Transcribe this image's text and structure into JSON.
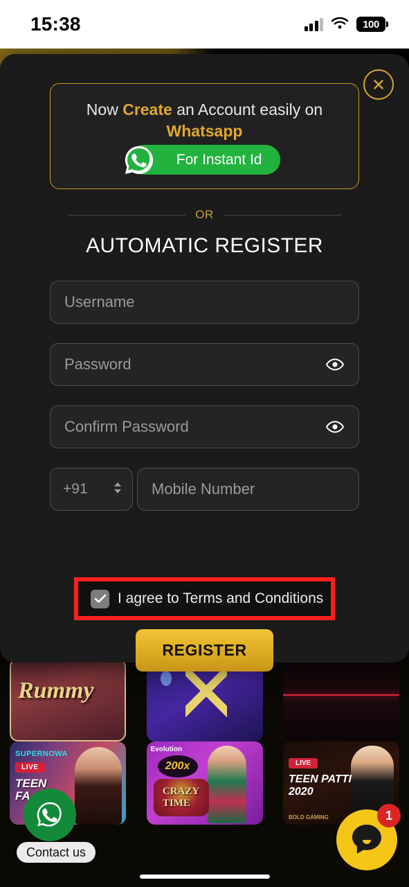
{
  "status_bar": {
    "time": "15:38",
    "battery_level": "100",
    "signal_icon": "cellular-signal-icon",
    "wifi_icon": "wifi-icon",
    "battery_icon": "battery-icon"
  },
  "background": {
    "login_button_label": "",
    "register_button_label": "",
    "cards_row_1": [
      {
        "name": "Rummy",
        "title": "Rummy"
      },
      {
        "name": "blue-game",
        "title": ""
      },
      {
        "name": "dark-game",
        "title": ""
      }
    ],
    "cards_row_2": [
      {
        "name": "teen-patti-fast",
        "provider": "SUPERNOWA",
        "live": "LIVE",
        "title": "TEEN PATTI\nFAST"
      },
      {
        "name": "crazy-time",
        "provider": "Evolution",
        "multiplier": "200x",
        "title": "CRAZY TIME"
      },
      {
        "name": "teen-patti-2020",
        "live": "LIVE",
        "title": "TEEN PATTI 2020",
        "provider": "BOLD GAMING"
      }
    ]
  },
  "modal": {
    "close_icon": "close-circle-icon",
    "promo": {
      "line1_pre": "Now ",
      "line1_accent": "Create",
      "line1_post": " an Account easily on",
      "line2_accent": "Whatsapp",
      "button_label": "For Instant Id",
      "button_icon": "whatsapp-icon"
    },
    "divider_label": "OR",
    "heading": "AUTOMATIC REGISTER",
    "fields": {
      "username": {
        "placeholder": "Username",
        "value": ""
      },
      "password": {
        "placeholder": "Password",
        "value": "",
        "toggle_icon": "eye-icon"
      },
      "confirm_password": {
        "placeholder": "Confirm Password",
        "value": "",
        "toggle_icon": "eye-icon"
      },
      "country_code": {
        "value": "+91",
        "chevron_icon": "chevron-up-down-icon"
      },
      "mobile_number": {
        "placeholder": "Mobile Number",
        "value": ""
      }
    },
    "terms": {
      "label": "I agree to Terms and Conditions",
      "checked": true,
      "check_icon": "checkmark-icon",
      "highlight_color": "#ff1f1f"
    },
    "submit_label": "REGISTER"
  },
  "floating": {
    "whatsapp_fab": {
      "icon": "whatsapp-icon",
      "label": "Contact us"
    },
    "chat_fab": {
      "icon": "chat-bubble-icon",
      "badge_count": "1"
    }
  },
  "colors": {
    "gold": "#d8a72a",
    "gold_text": "#e0a82e",
    "whatsapp_green": "#22b33f",
    "modal_bg": "#1b1b1b",
    "highlight_red": "#ff1f1f",
    "chat_yellow": "#f5c518",
    "badge_red": "#dc2626"
  }
}
